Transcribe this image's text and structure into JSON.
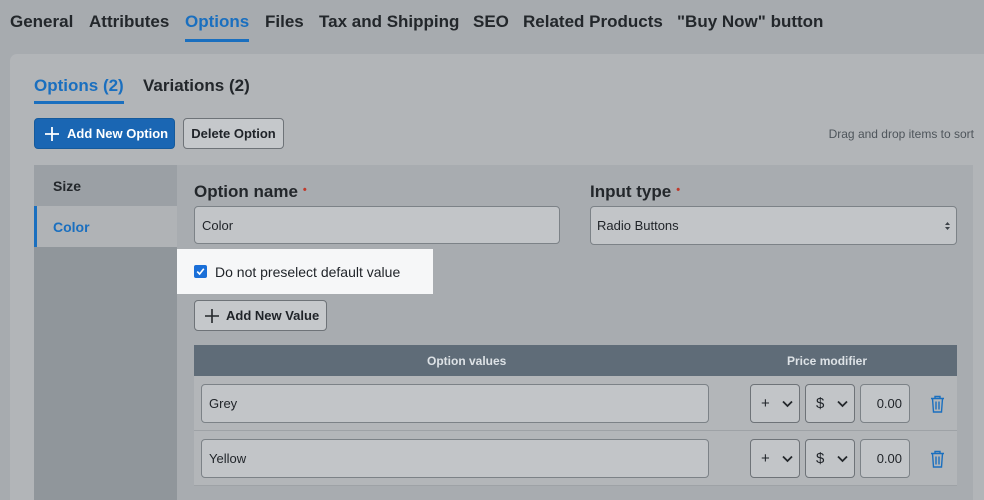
{
  "top_tabs": [
    "General",
    "Attributes",
    "Options",
    "Files",
    "Tax and Shipping",
    "SEO",
    "Related Products",
    "\"Buy Now\" button"
  ],
  "sub_tabs": [
    "Options (2)",
    "Variations (2)"
  ],
  "toolbar": {
    "add_option": "Add New Option",
    "delete_option": "Delete Option",
    "sort_hint": "Drag and drop items to sort"
  },
  "options_list": [
    "Size",
    "Color"
  ],
  "form": {
    "option_name_label": "Option name",
    "option_name_value": "Color",
    "input_type_label": "Input type",
    "input_type_value": "Radio Buttons",
    "required_mark": "•",
    "no_preselect_label": "Do not preselect default value",
    "no_preselect_checked": true,
    "add_value": "Add New Value"
  },
  "values_table": {
    "headers": [
      "Option values",
      "Price modifier"
    ],
    "rows": [
      {
        "value": "Grey",
        "sign": "+",
        "type": "$",
        "amount": "0.00"
      },
      {
        "value": "Yellow",
        "sign": "+",
        "type": "$",
        "amount": "0.00"
      }
    ]
  },
  "colors": {
    "accent": "#1a6fbf",
    "primary_button": "#1a66b3",
    "table_header": "#5f6c78",
    "required": "#c0392b"
  },
  "icons": {
    "add": "plus-icon",
    "delete_row": "trash-icon",
    "select": "chevron-down-icon",
    "checkbox": "check-icon"
  }
}
